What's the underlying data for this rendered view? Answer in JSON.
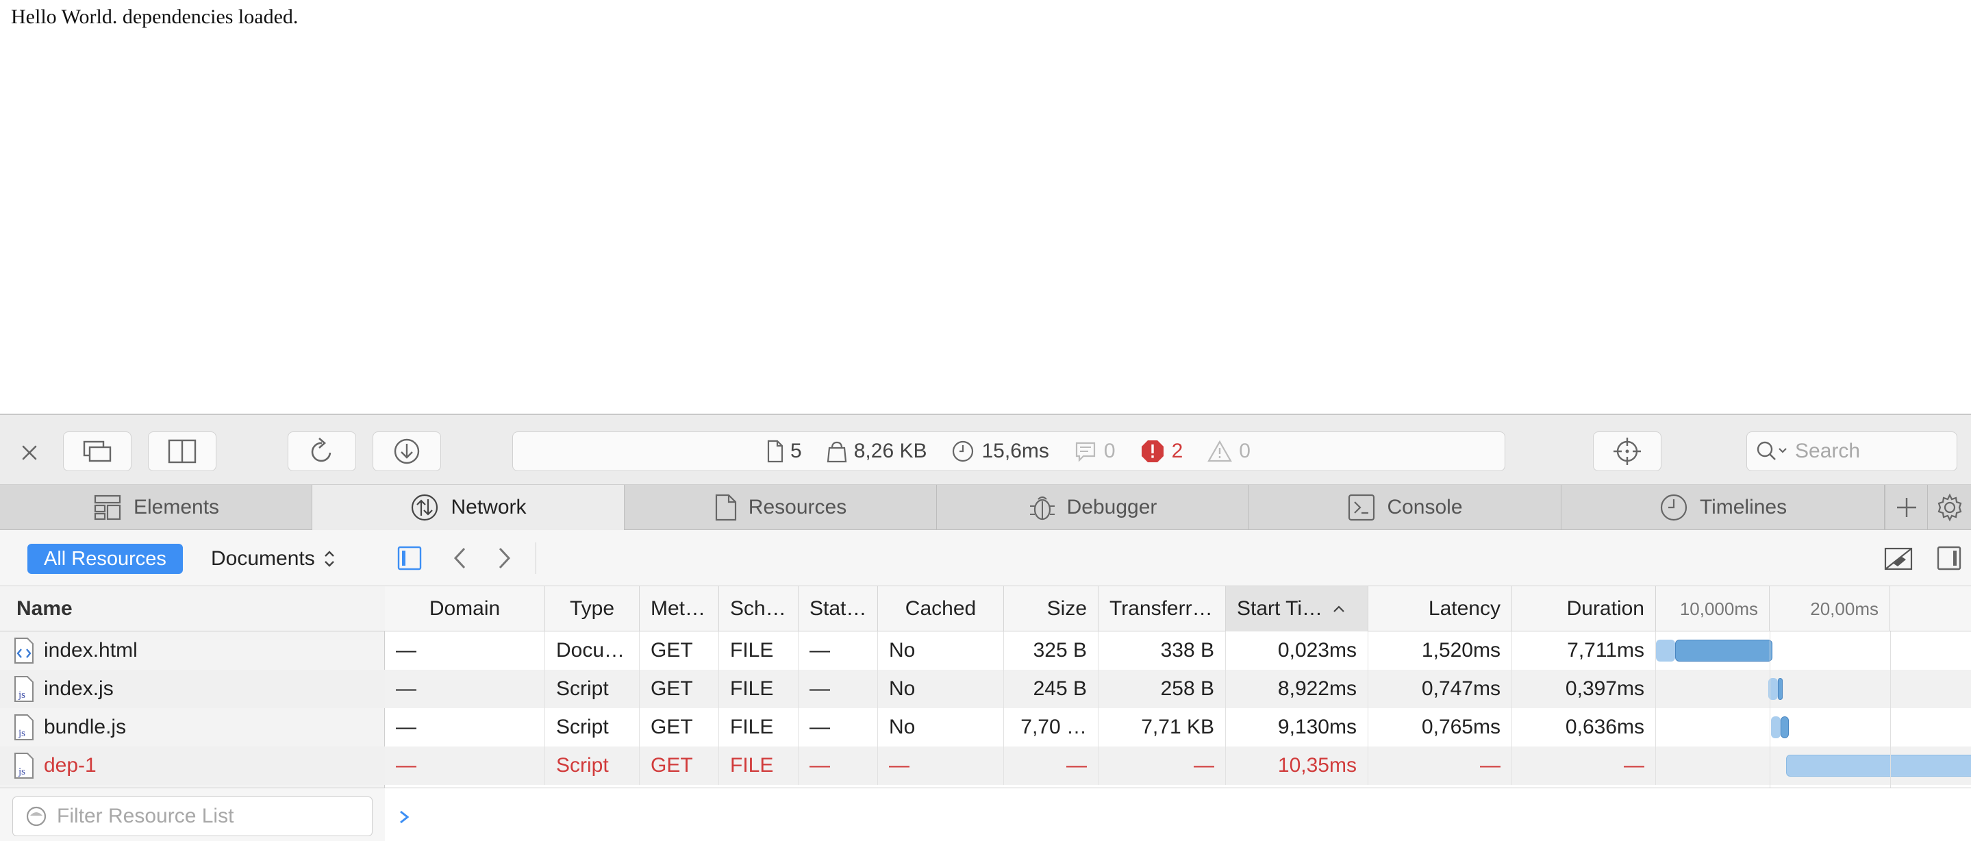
{
  "page": {
    "text": "Hello World. dependencies loaded."
  },
  "toolbar": {
    "stats": {
      "resources": "5",
      "size": "8,26 KB",
      "time": "15,6ms",
      "logs": "0",
      "errors": "2",
      "warnings": "0"
    },
    "search_placeholder": "Search"
  },
  "tabs": [
    {
      "label": "Elements",
      "icon": "elements-icon"
    },
    {
      "label": "Network",
      "icon": "network-icon"
    },
    {
      "label": "Resources",
      "icon": "resources-icon"
    },
    {
      "label": "Debugger",
      "icon": "debugger-icon"
    },
    {
      "label": "Console",
      "icon": "console-icon"
    },
    {
      "label": "Timelines",
      "icon": "timelines-icon"
    }
  ],
  "sidebar": {
    "scope_all": "All Resources",
    "scope_type": "Documents",
    "name_header": "Name",
    "filter_placeholder": "Filter Resource List"
  },
  "grid": {
    "headers": {
      "domain": "Domain",
      "type": "Type",
      "method": "Met…",
      "scheme": "Sch…",
      "status": "Stat…",
      "cached": "Cached",
      "size": "Size",
      "transferred": "Transferr…",
      "start": "Start Ti…",
      "latency": "Latency",
      "duration": "Duration",
      "tick1": "10,000ms",
      "tick2": "20,00ms"
    },
    "rows": [
      {
        "name": "index.html",
        "icon": "html-file-icon",
        "domain": "—",
        "type": "Docu…",
        "method": "GET",
        "scheme": "FILE",
        "status": "—",
        "cached": "No",
        "size": "325 B",
        "transferred": "338 B",
        "start": "0,023ms",
        "latency": "1,520ms",
        "duration": "7,711ms",
        "error": false
      },
      {
        "name": "index.js",
        "icon": "js-file-icon",
        "domain": "—",
        "type": "Script",
        "method": "GET",
        "scheme": "FILE",
        "status": "—",
        "cached": "No",
        "size": "245 B",
        "transferred": "258 B",
        "start": "8,922ms",
        "latency": "0,747ms",
        "duration": "0,397ms",
        "error": false
      },
      {
        "name": "bundle.js",
        "icon": "js-file-icon",
        "domain": "—",
        "type": "Script",
        "method": "GET",
        "scheme": "FILE",
        "status": "—",
        "cached": "No",
        "size": "7,70 …",
        "transferred": "7,71 KB",
        "start": "9,130ms",
        "latency": "0,765ms",
        "duration": "0,636ms",
        "error": false
      },
      {
        "name": "dep-1",
        "icon": "js-file-icon",
        "domain": "—",
        "type": "Script",
        "method": "GET",
        "scheme": "FILE",
        "status": "—",
        "cached": "—",
        "size": "—",
        "transferred": "—",
        "start": "10,35ms",
        "latency": "—",
        "duration": "—",
        "error": true
      }
    ]
  },
  "colors": {
    "accent": "#3d8ff4",
    "error": "#d13b3b",
    "bar": "#6aa6da",
    "bar_light": "#a9cdee"
  }
}
